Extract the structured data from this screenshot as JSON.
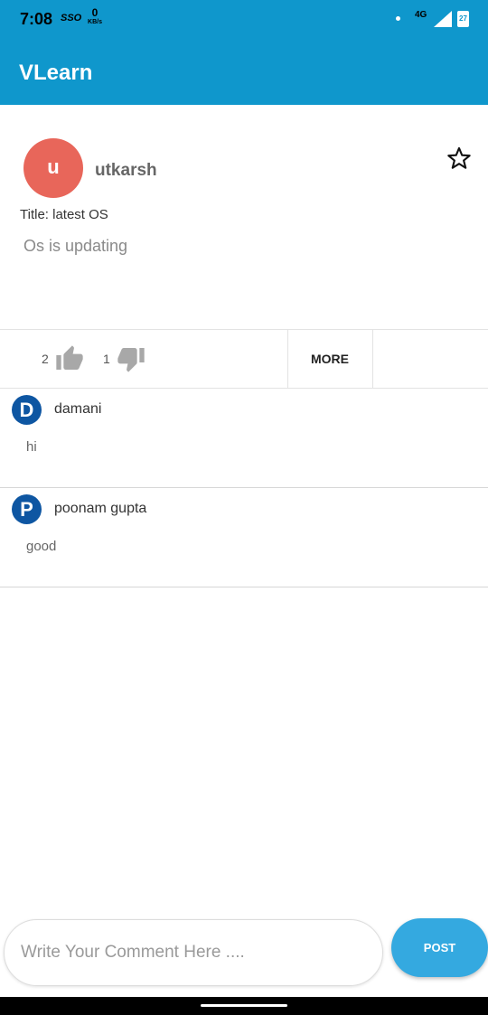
{
  "status_bar": {
    "time": "7:08",
    "carrier_badge": "SSO",
    "net_speed": "0",
    "net_unit": "KB/s",
    "network_type": "4G",
    "battery": "27"
  },
  "app_bar": {
    "title": "VLearn"
  },
  "post": {
    "avatar_letter": "u",
    "author": "utkarsh",
    "title": "Title: latest OS",
    "body": "Os is updating",
    "likes": "2",
    "dislikes": "1",
    "more_label": "MORE"
  },
  "comments": [
    {
      "avatar_letter": "D",
      "name": "damani",
      "text": "hi"
    },
    {
      "avatar_letter": "P",
      "name": "poonam gupta",
      "text": "good"
    }
  ],
  "composer": {
    "placeholder": "Write Your Comment Here ....",
    "value": "",
    "post_label": "POST"
  },
  "colors": {
    "primary": "#0f97cc",
    "avatar_u": "#e8665a",
    "comment_avatar": "#0e56a2",
    "post_button": "#34a9e0"
  }
}
